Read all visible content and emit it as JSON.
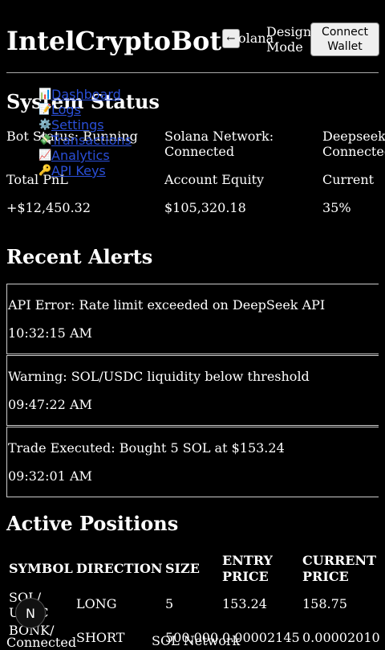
{
  "header": {
    "title": "IntelCryptoBot",
    "back_glyph": "←",
    "network_label": "olana",
    "design_mode": "Design Mode",
    "connect_wallet": "Connect Wallet"
  },
  "nav": {
    "items": [
      {
        "icon": "dashboard-icon",
        "glyph": "📊",
        "label": "Dashboard"
      },
      {
        "icon": "logs-icon",
        "glyph": "📝",
        "label": "Logs"
      },
      {
        "icon": "settings-icon",
        "glyph": "⚙️",
        "label": "Settings"
      },
      {
        "icon": "transactions-icon",
        "glyph": "💸",
        "label": "Transactions"
      },
      {
        "icon": "analytics-icon",
        "glyph": "📈",
        "label": "Analytics"
      },
      {
        "icon": "api-keys-icon",
        "glyph": "🔑",
        "label": "API Keys"
      }
    ]
  },
  "system_status": {
    "title": "System Status",
    "bot_status": "Bot Status: Running",
    "solana_network": "Solana Network: Connected",
    "deepseek": "Deepseek: Connected",
    "total_pnl_label": "Total PnL",
    "total_pnl_value": "+$12,450.32",
    "equity_label": "Account Equity",
    "equity_value": "$105,320.18",
    "current_label": "Current",
    "current_value": "35%"
  },
  "alerts": {
    "title": "Recent Alerts",
    "items": [
      {
        "message": "API Error: Rate limit exceeded on DeepSeek API",
        "time": "10:32:15 AM"
      },
      {
        "message": "Warning: SOL/USDC liquidity below threshold",
        "time": "09:47:22 AM"
      },
      {
        "message": "Trade Executed: Bought 5 SOL at $153.24",
        "time": "09:32:01 AM"
      }
    ]
  },
  "positions": {
    "title": "Active Positions",
    "headers": {
      "symbol": "SYMBOL",
      "direction": "DIRECTION",
      "size": "SIZE",
      "entry": "ENTRY PRICE",
      "current": "CURRENT PRICE"
    },
    "rows": [
      {
        "symbol": "SOL/ USDC",
        "direction": "LONG",
        "size": "5",
        "entry": "153.24",
        "current": "158.75"
      },
      {
        "symbol": "BONK/",
        "direction": "SHORT",
        "size": "500,000",
        "entry": "0.00002145",
        "current": "0.00002010"
      }
    ]
  },
  "footer": {
    "connected": "Connected",
    "network": "SOL Network",
    "avatar_letter": "N"
  }
}
